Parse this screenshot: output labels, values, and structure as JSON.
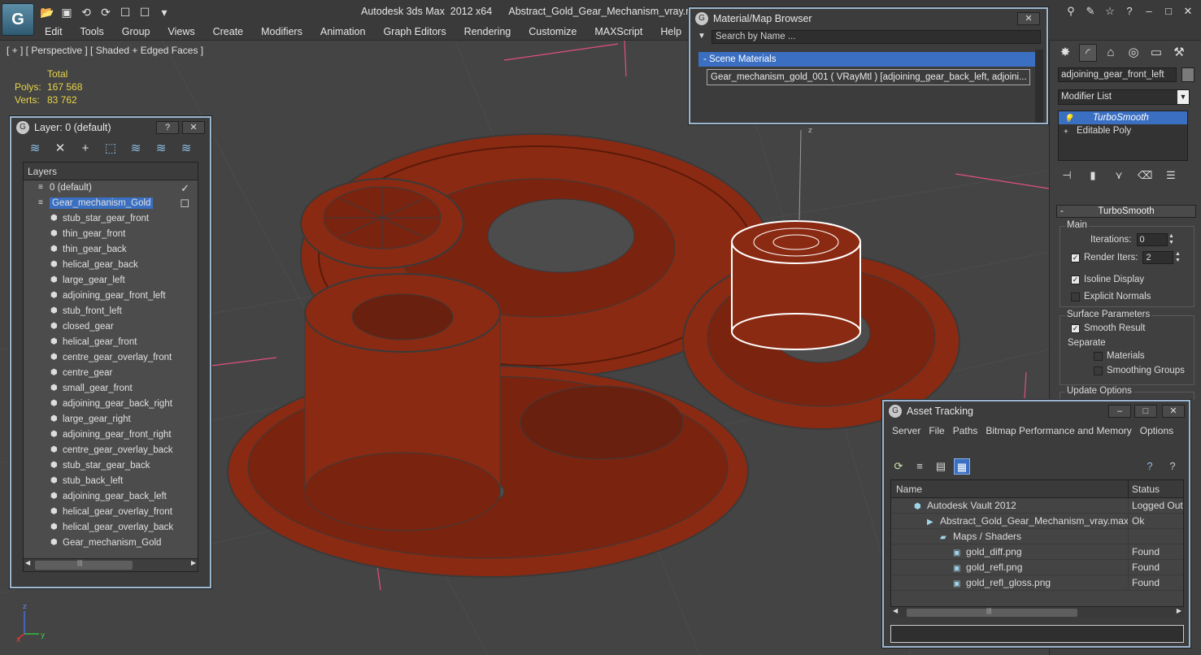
{
  "window": {
    "title": "Autodesk 3ds Max  2012 x64      Abstract_Gold_Gear_Mechanism_vray.max"
  },
  "menu": [
    "Edit",
    "Tools",
    "Group",
    "Views",
    "Create",
    "Modifiers",
    "Animation",
    "Graph Editors",
    "Rendering",
    "Customize",
    "MAXScript",
    "Help"
  ],
  "viewport": {
    "label": "[ + ] [ Perspective ] [ Shaded + Edged Faces ]",
    "stats": {
      "total_label": "Total",
      "polys_label": "Polys:",
      "polys_value": "167 568",
      "verts_label": "Verts:",
      "verts_value": "83 762"
    },
    "axis": {
      "z": "z",
      "x": "x",
      "y": "y"
    },
    "gizmo_label": "z"
  },
  "layer_dialog": {
    "title": "Layer: 0 (default)",
    "help_btn": "?",
    "close_btn": "✕",
    "header": "Layers",
    "layers": [
      {
        "name": "0 (default)",
        "level": 0
      },
      {
        "name": "Gear_mechanism_Gold",
        "level": 0,
        "selected": true
      }
    ],
    "objects": [
      "stub_star_gear_front",
      "thin_gear_front",
      "thin_gear_back",
      "helical_gear_back",
      "large_gear_left",
      "adjoining_gear_front_left",
      "stub_front_left",
      "closed_gear",
      "helical_gear_front",
      "centre_gear_overlay_front",
      "centre_gear",
      "small_gear_front",
      "adjoining_gear_back_right",
      "large_gear_right",
      "adjoining_gear_front_right",
      "centre_gear_overlay_back",
      "stub_star_gear_back",
      "stub_back_left",
      "adjoining_gear_back_left",
      "helical_gear_overlay_front",
      "helical_gear_overlay_back",
      "Gear_mechanism_Gold"
    ],
    "scroll_left": "◀",
    "scroll_right": "▶",
    "scroll_grip": "|||"
  },
  "material_browser": {
    "title": "Material/Map Browser",
    "search_placeholder": "Search by Name ...",
    "group": "- Scene Materials",
    "item": "Gear_mechanism_gold_001  ( VRayMtl )  [adjoining_gear_back_left, adjoini..."
  },
  "command_panel": {
    "object_name": "adjoining_gear_front_left",
    "modifier_list": "Modifier List",
    "stack": [
      {
        "name": "TurboSmooth",
        "selected": true
      },
      {
        "name": "Editable Poly",
        "selected": false
      }
    ],
    "rollout_title": "TurboSmooth",
    "main_label": "Main",
    "iterations_label": "Iterations:",
    "iterations_value": "0",
    "render_iters_label": "Render Iters:",
    "render_iters_value": "2",
    "isoline_label": "Isoline Display",
    "explicit_label": "Explicit Normals",
    "surface_label": "Surface Parameters",
    "smooth_label": "Smooth Result",
    "separate_label": "Separate",
    "materials_label": "Materials",
    "smoothing_label": "Smoothing Groups",
    "update_label": "Update Options"
  },
  "asset_tracking": {
    "title": "Asset Tracking",
    "menu": [
      "Server",
      "File",
      "Paths",
      "Bitmap Performance and Memory",
      "Options"
    ],
    "col_name": "Name",
    "col_status": "Status",
    "rows": [
      {
        "name": "Autodesk Vault 2012",
        "status": "Logged Out",
        "indent": 28
      },
      {
        "name": "Abstract_Gold_Gear_Mechanism_vray.max",
        "status": "Ok",
        "indent": 44
      },
      {
        "name": "Maps / Shaders",
        "status": "",
        "indent": 60
      },
      {
        "name": "gold_diff.png",
        "status": "Found",
        "indent": 76
      },
      {
        "name": "gold_refl.png",
        "status": "Found",
        "indent": 76
      },
      {
        "name": "gold_refl_gloss.png",
        "status": "Found",
        "indent": 76
      }
    ],
    "scroll_left": "◀",
    "scroll_right": "▶",
    "scroll_grip": "|||"
  },
  "colors": {
    "gear": "#8b2a12",
    "wire": "#5a5a5a",
    "selection": "#3a6fc2",
    "grid": "#505050"
  }
}
